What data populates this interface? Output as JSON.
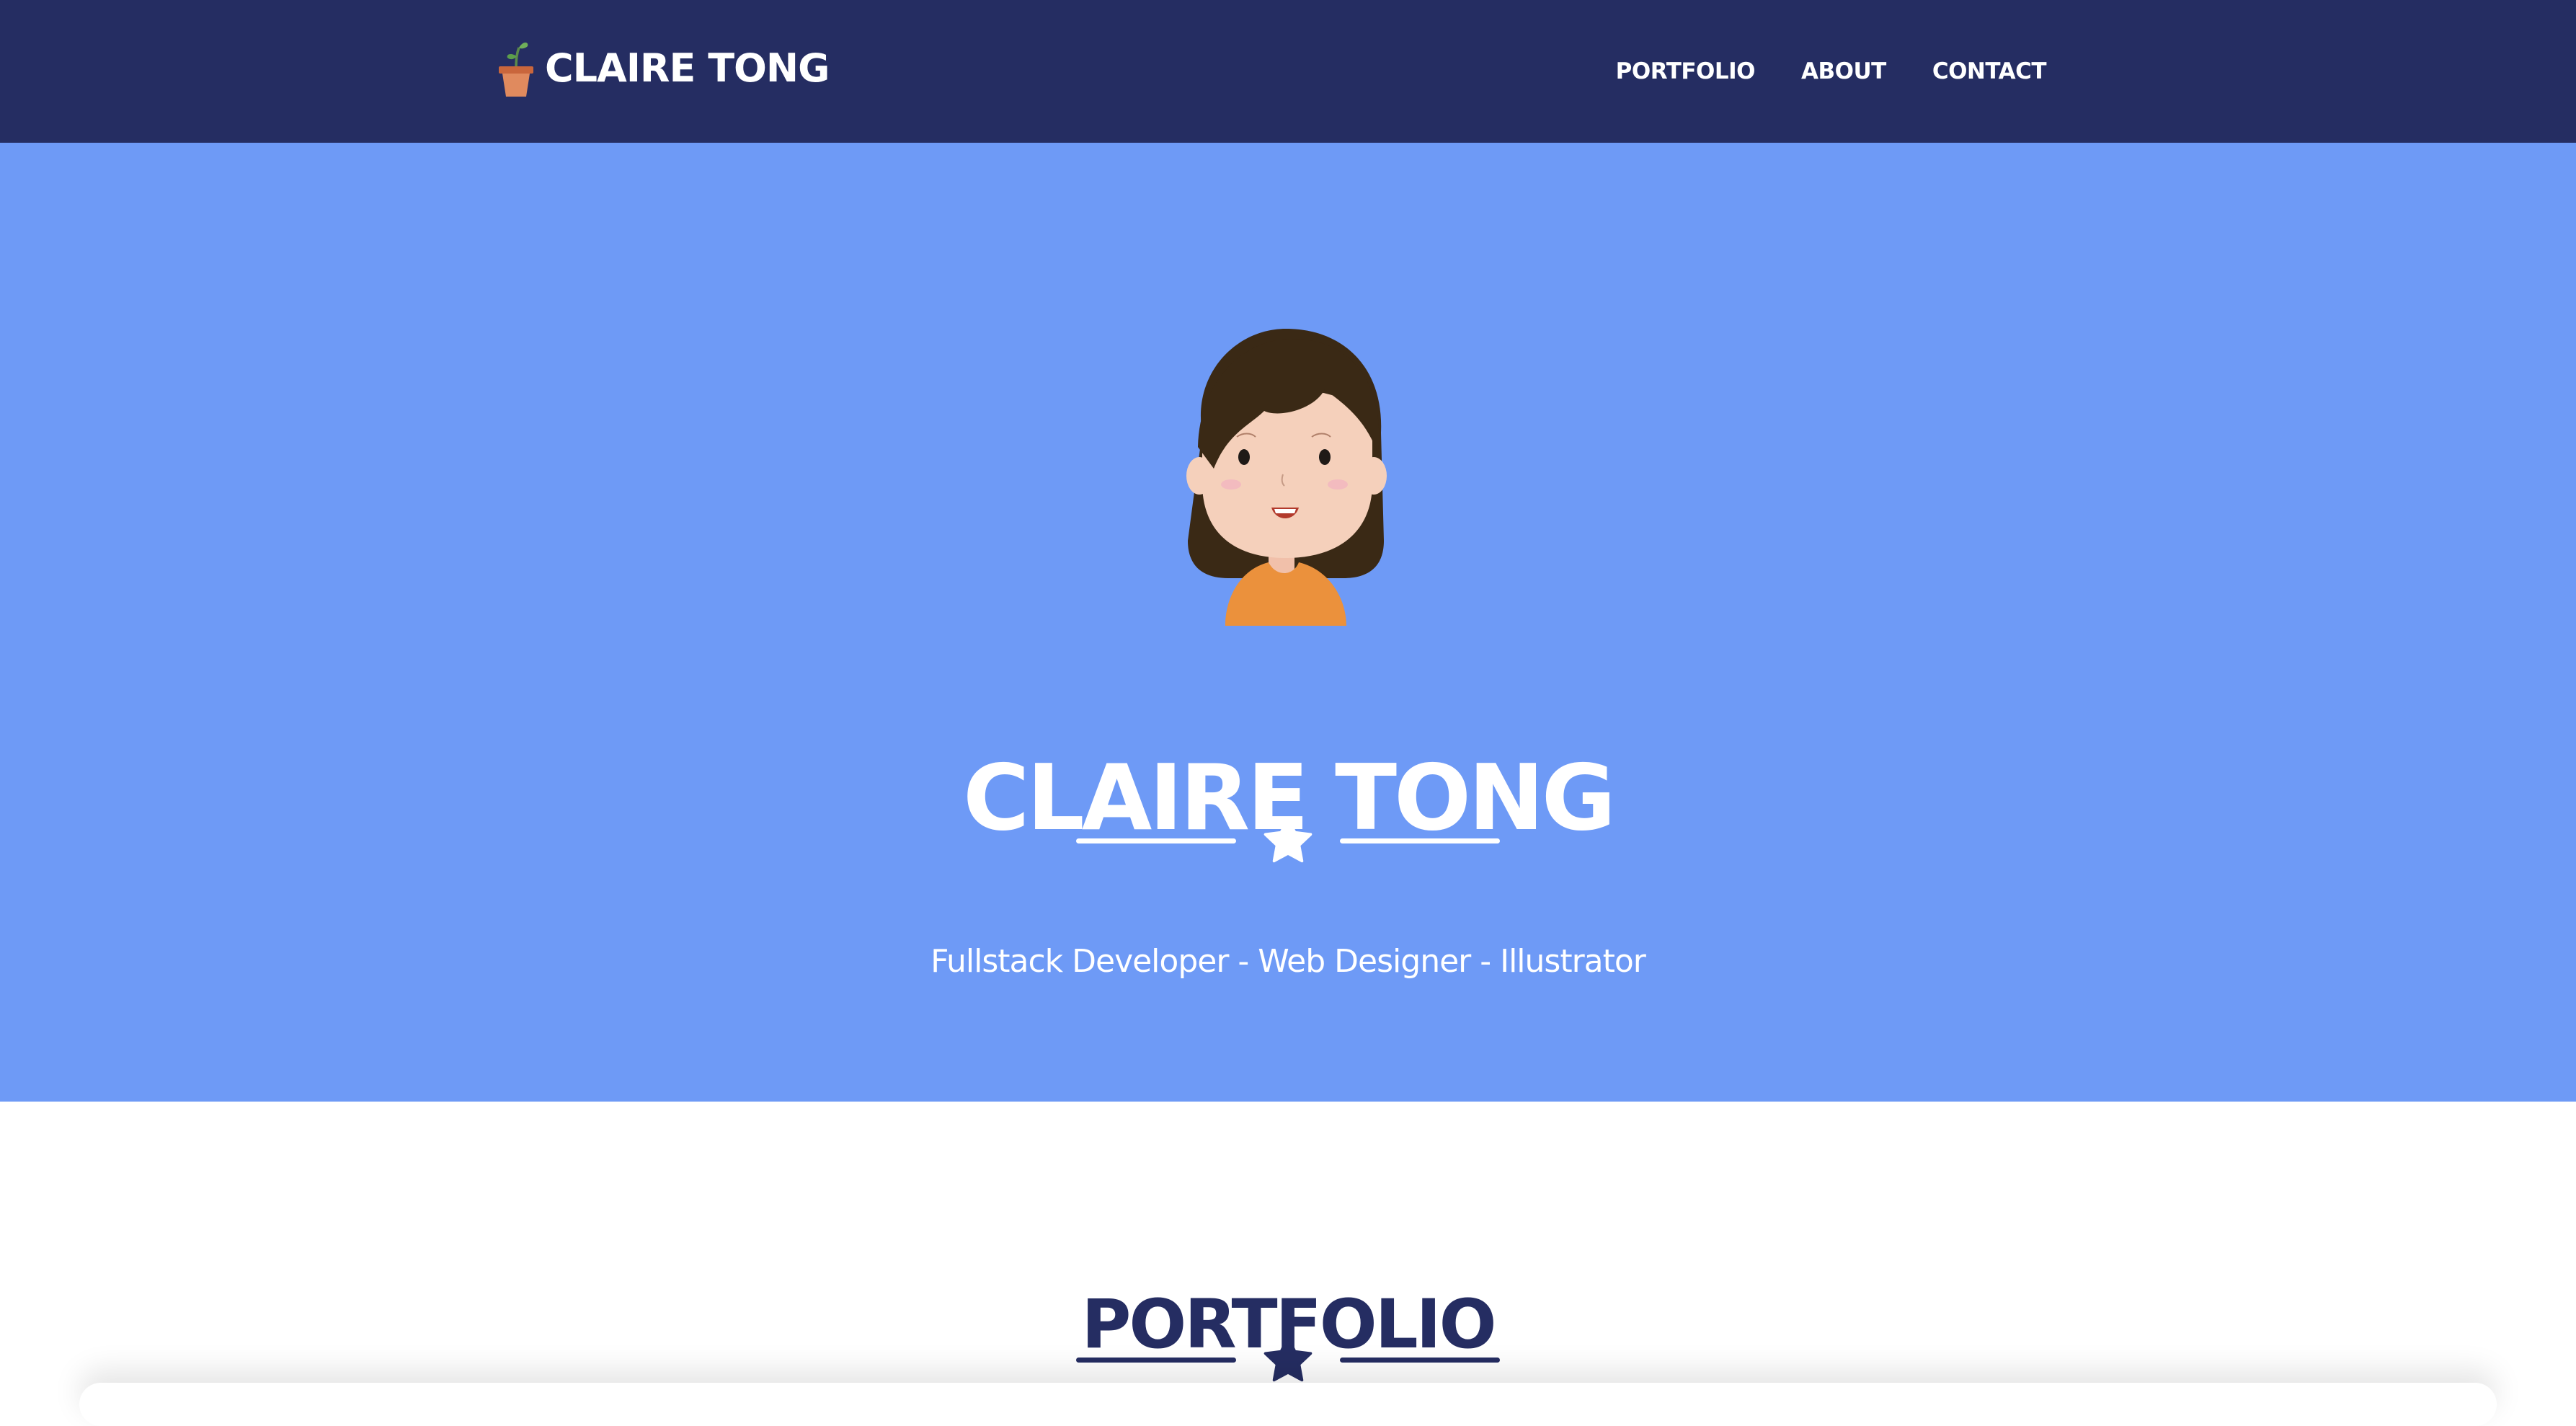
{
  "navbar": {
    "brand_name": "CLAIRE TONG",
    "brand_icon": "potted-plant-icon",
    "links": [
      {
        "label": "PORTFOLIO"
      },
      {
        "label": "ABOUT"
      },
      {
        "label": "CONTACT"
      }
    ]
  },
  "hero": {
    "avatar": "girl-avatar-illustration",
    "title": "CLAIRE TONG",
    "divider_icon": "star-icon",
    "subtitle": "Fullstack Developer - Web Designer - Illustrator"
  },
  "portfolio": {
    "title": "PORTFOLIO",
    "divider_icon": "star-icon"
  },
  "colors": {
    "navbar_bg": "#252d62",
    "hero_bg": "#6e9af6",
    "text_light": "#ffffff",
    "text_dark": "#252d62",
    "hair": "#3a2915",
    "skin": "#f5d0bb",
    "shirt": "#eb913c",
    "pot": "#d97b4f"
  }
}
